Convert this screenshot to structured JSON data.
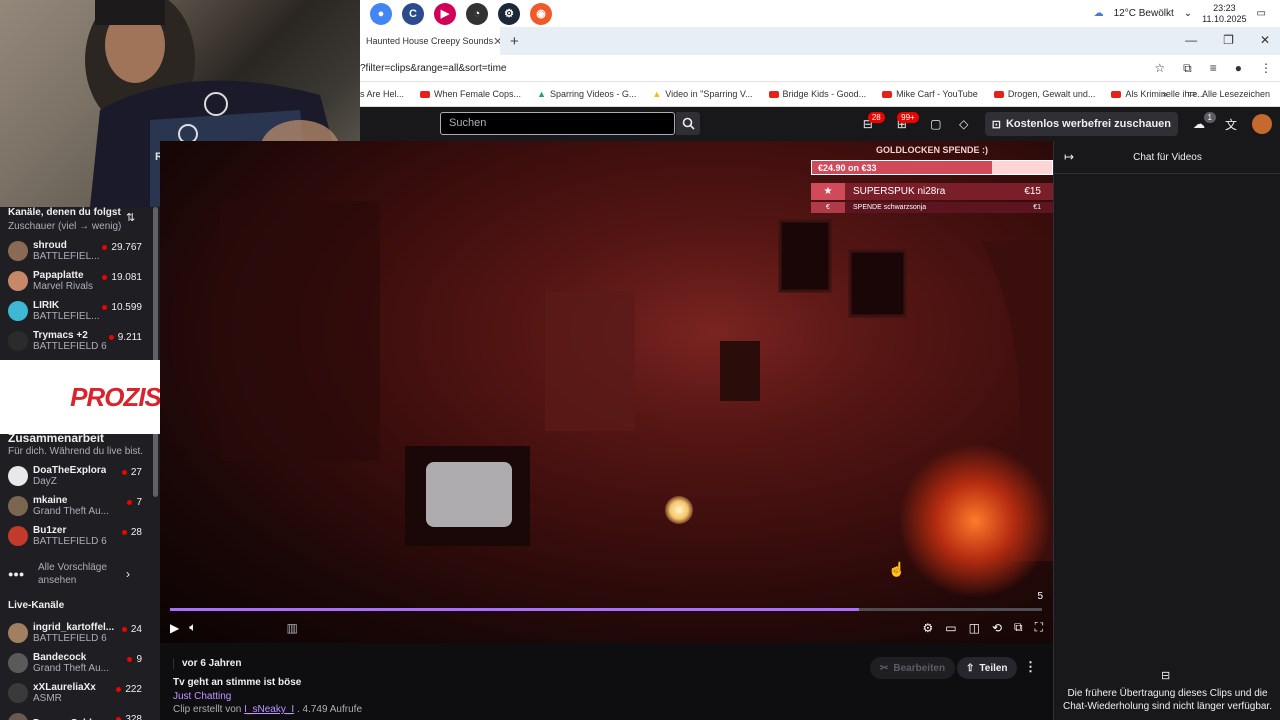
{
  "taskbar": {
    "apps": [
      "chrome",
      "ccleaner",
      "media-player",
      "speedometer",
      "steam",
      "origin"
    ],
    "weather": "12°C  Bewölkt",
    "time": "23:23",
    "date": "11.10.2025"
  },
  "browser": {
    "tab_title": "Haunted House Creepy Sounds",
    "url": "?filter=clips&range=all&sort=time",
    "bookmarks": [
      "s Are Hel...",
      "When Female Cops...",
      "Sparring Videos - G...",
      "Video in \"Sparring V...",
      "Bridge Kids - Good...",
      "Mike Carf - YouTube",
      "Drogen, Gewalt und...",
      "Als Kriminelle ihre..."
    ],
    "all_bookmarks": "Alle Lesezeichen"
  },
  "topnav": {
    "search_placeholder": "Suchen",
    "inbox_badge": "28",
    "whispers_badge": "99+",
    "promo_label": "Kostenlos werbefrei zuschauen",
    "drops_badge": "1"
  },
  "sidebar": {
    "followed_heading": "Kanäle, denen du folgst",
    "followed_sort": "Zuschauer (viel → wenig)",
    "followed": [
      {
        "name": "shroud",
        "game": "BATTLEFIEL...",
        "viewers": "29.767",
        "color": "#8a6a55"
      },
      {
        "name": "Papaplatte",
        "game": "Marvel Rivals",
        "viewers": "19.081",
        "color": "#c7886a"
      },
      {
        "name": "LIRIK",
        "game": "BATTLEFIEL...",
        "viewers": "10.599",
        "color": "#3fb8d6"
      },
      {
        "name": "Trymacs +2",
        "game": "BATTLEFIELD 6",
        "viewers": "9.211",
        "color": "#2b2b2b"
      }
    ],
    "collab_heading": "Zusammenarbeit",
    "collab_sub": "Für dich. Während du live bist.",
    "collab": [
      {
        "name": "DoaTheExplora",
        "game": "DayZ",
        "viewers": "27",
        "color": "#e8e8e8"
      },
      {
        "name": "mkaine",
        "game": "Grand Theft Au...",
        "viewers": "7",
        "color": "#7a6650"
      },
      {
        "name": "Bu1zer",
        "game": "BATTLEFIELD 6",
        "viewers": "28",
        "color": "#c23a2a"
      }
    ],
    "all_suggestions": "Alle Vorschläge ansehen",
    "live_heading": "Live-Kanäle",
    "live": [
      {
        "name": "ingrid_kartoffel...",
        "game": "BATTLEFIELD 6",
        "viewers": "24",
        "color": "#a08060"
      },
      {
        "name": "Bandecock",
        "game": "Grand Theft Au...",
        "viewers": "9",
        "color": "#5a5a5a"
      },
      {
        "name": "xXLaureliaXx",
        "game": "ASMR",
        "viewers": "222",
        "color": "#3a3a3a"
      },
      {
        "name": "DwayneSchlap...",
        "game": "",
        "viewers": "328",
        "color": "#6a5a50"
      }
    ]
  },
  "ad": {
    "brand": "PROZIS"
  },
  "video": {
    "overlay_title": "GOLDLOCKEN SPENDE :)",
    "goal_text": "€24.90 on €33",
    "goal_progress": 0.75,
    "donor_name": "SUPERSPUK ni28ra",
    "donor_amount": "€15",
    "spende_label": "SPENDE schwarzsonja",
    "spende_amount": "€1",
    "progress": 0.79,
    "time_remaining": "5"
  },
  "clip": {
    "ago": "vor 6 Jahren",
    "title": "Tv geht an stimme ist böse",
    "category": "Just Chatting",
    "created_prefix": "Clip erstellt von ",
    "creator": "I_sNeaky_I",
    "views": " . 4.749 Aufrufe",
    "edit_label": "Bearbeiten",
    "share_label": "Teilen"
  },
  "chat": {
    "title": "Chat für Videos",
    "message": "Die frühere Übertragung dieses Clips und die Chat-Wiederholung sind nicht länger verfügbar."
  }
}
